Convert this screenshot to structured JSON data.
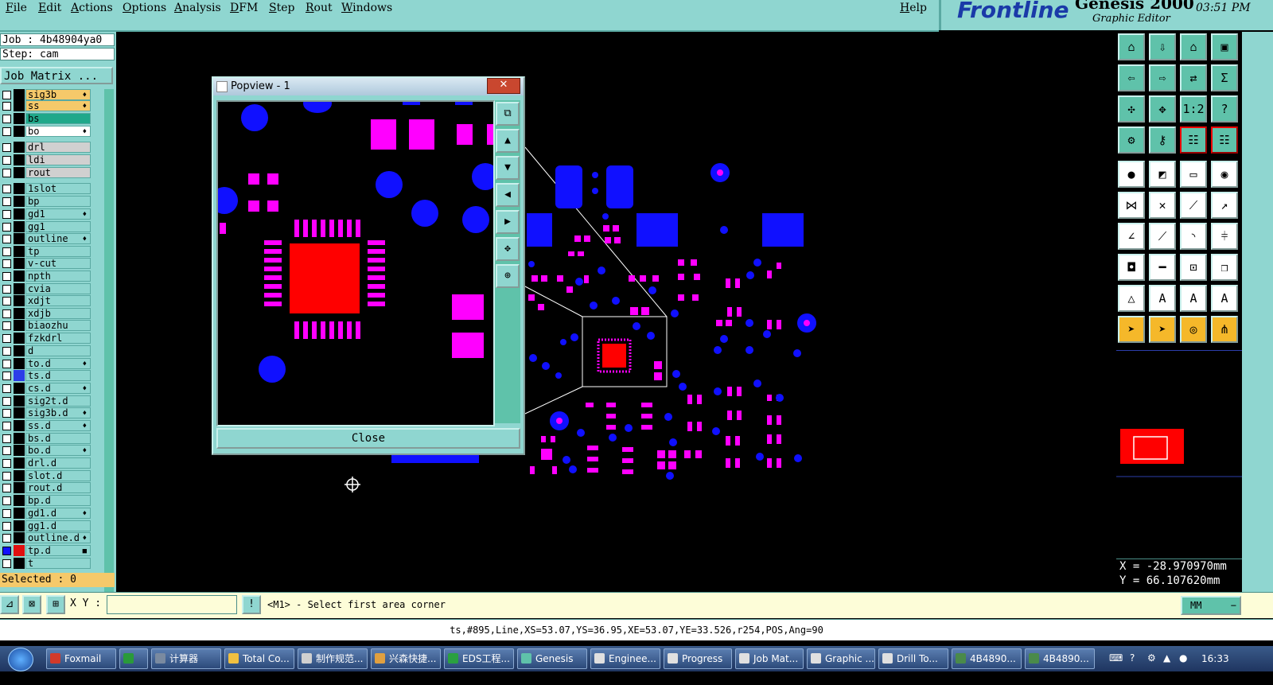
{
  "menubar": {
    "items": [
      "File",
      "Edit",
      "Actions",
      "Options",
      "Analysis",
      "DFM",
      "Step",
      "Rout",
      "Windows"
    ],
    "help": "Help"
  },
  "branding": {
    "brand": "Frontline",
    "product": "Genesis 2000",
    "subtitle": "Graphic Editor",
    "clock": "03:51 PM"
  },
  "job": {
    "job_line": "Job : 4b48904ya0",
    "step_line": "Step: cam",
    "matrix_button": "Job Matrix ...",
    "selected": "Selected : 0"
  },
  "layers": [
    {
      "name": "sig3b",
      "color": "#f5c96a",
      "swatch": "#000000",
      "flag": "♦",
      "checked": false
    },
    {
      "name": "ss",
      "color": "#f5c96a",
      "swatch": "#000000",
      "flag": "♦",
      "checked": false
    },
    {
      "name": "bs",
      "color": "#1fa88a",
      "swatch": "#000000",
      "flag": "",
      "checked": false
    },
    {
      "name": "bo",
      "color": "#ffffff",
      "swatch": "#000000",
      "flag": "♦",
      "checked": false
    },
    {
      "name": "drl",
      "color": "#d0d0d0",
      "swatch": "#000000",
      "flag": "",
      "checked": false
    },
    {
      "name": "ldi",
      "color": "#d0d0d0",
      "swatch": "#000000",
      "flag": "",
      "checked": false
    },
    {
      "name": "rout",
      "color": "#d0d0d0",
      "swatch": "#000000",
      "flag": "",
      "checked": false
    },
    {
      "name": "1slot",
      "color": "#8fd6d0",
      "swatch": "#000000",
      "flag": "",
      "checked": false
    },
    {
      "name": "bp",
      "color": "#8fd6d0",
      "swatch": "#000000",
      "flag": "",
      "checked": false
    },
    {
      "name": "gd1",
      "color": "#8fd6d0",
      "swatch": "#000000",
      "flag": "♦",
      "checked": false
    },
    {
      "name": "gg1",
      "color": "#8fd6d0",
      "swatch": "#000000",
      "flag": "",
      "checked": false
    },
    {
      "name": "outline",
      "color": "#8fd6d0",
      "swatch": "#000000",
      "flag": "♦",
      "checked": false
    },
    {
      "name": "tp",
      "color": "#8fd6d0",
      "swatch": "#000000",
      "flag": "",
      "checked": false
    },
    {
      "name": "v-cut",
      "color": "#8fd6d0",
      "swatch": "#000000",
      "flag": "",
      "checked": false
    },
    {
      "name": "npth",
      "color": "#8fd6d0",
      "swatch": "#000000",
      "flag": "",
      "checked": false
    },
    {
      "name": "cvia",
      "color": "#8fd6d0",
      "swatch": "#000000",
      "flag": "",
      "checked": false
    },
    {
      "name": "xdjt",
      "color": "#8fd6d0",
      "swatch": "#000000",
      "flag": "",
      "checked": false
    },
    {
      "name": "xdjb",
      "color": "#8fd6d0",
      "swatch": "#000000",
      "flag": "",
      "checked": false
    },
    {
      "name": "biaozhu",
      "color": "#8fd6d0",
      "swatch": "#000000",
      "flag": "",
      "checked": false
    },
    {
      "name": "fzkdrl",
      "color": "#8fd6d0",
      "swatch": "#000000",
      "flag": "",
      "checked": false
    },
    {
      "name": "d",
      "color": "#8fd6d0",
      "swatch": "#000000",
      "flag": "",
      "checked": false
    },
    {
      "name": "to.d",
      "color": "#8fd6d0",
      "swatch": "#000000",
      "flag": "♦",
      "checked": false
    },
    {
      "name": "ts.d",
      "color": "#8fd6d0",
      "swatch": "#2c3ee8",
      "flag": "",
      "checked": false
    },
    {
      "name": "cs.d",
      "color": "#8fd6d0",
      "swatch": "#000000",
      "flag": "♦",
      "checked": false
    },
    {
      "name": "sig2t.d",
      "color": "#8fd6d0",
      "swatch": "#000000",
      "flag": "",
      "checked": false
    },
    {
      "name": "sig3b.d",
      "color": "#8fd6d0",
      "swatch": "#000000",
      "flag": "♦",
      "checked": false
    },
    {
      "name": "ss.d",
      "color": "#8fd6d0",
      "swatch": "#000000",
      "flag": "♦",
      "checked": false
    },
    {
      "name": "bs.d",
      "color": "#8fd6d0",
      "swatch": "#000000",
      "flag": "",
      "checked": false
    },
    {
      "name": "bo.d",
      "color": "#8fd6d0",
      "swatch": "#000000",
      "flag": "♦",
      "checked": false
    },
    {
      "name": "drl.d",
      "color": "#8fd6d0",
      "swatch": "#000000",
      "flag": "",
      "checked": false
    },
    {
      "name": "slot.d",
      "color": "#8fd6d0",
      "swatch": "#000000",
      "flag": "",
      "checked": false
    },
    {
      "name": "rout.d",
      "color": "#8fd6d0",
      "swatch": "#000000",
      "flag": "",
      "checked": false
    },
    {
      "name": "bp.d",
      "color": "#8fd6d0",
      "swatch": "#000000",
      "flag": "",
      "checked": false
    },
    {
      "name": "gd1.d",
      "color": "#8fd6d0",
      "swatch": "#000000",
      "flag": "♦",
      "checked": false
    },
    {
      "name": "gg1.d",
      "color": "#8fd6d0",
      "swatch": "#000000",
      "flag": "",
      "checked": false
    },
    {
      "name": "outline.d",
      "color": "#8fd6d0",
      "swatch": "#000000",
      "flag": "♦",
      "checked": false
    },
    {
      "name": "tp.d",
      "color": "#8fd6d0",
      "swatch": "#e01010",
      "flag": "■",
      "checked": true
    },
    {
      "name": "t",
      "color": "#8fd6d0",
      "swatch": "#000000",
      "flag": "",
      "checked": false
    }
  ],
  "popview": {
    "title": "Popview - 1",
    "close_label": "Close"
  },
  "command": {
    "xy_label": "X Y :",
    "xy_value": "",
    "prompt": "<M1> - Select first area corner",
    "units": "MM"
  },
  "coords": {
    "x": "X = -28.970970mm",
    "y": "Y =  66.107620mm"
  },
  "status_line": "ts,#895,Line,XS=53.07,YS=36.95,XE=53.07,YE=33.526,r254,POS,Ang=90",
  "taskbar": {
    "items": [
      {
        "label": "Foxmail",
        "icon": "#d23a2a"
      },
      {
        "label": "",
        "icon": "#2a9a3a"
      },
      {
        "label": "计算器",
        "icon": "#7a8aa0"
      },
      {
        "label": "Total Co...",
        "icon": "#f0c040"
      },
      {
        "label": "制作规范...",
        "icon": "#d0d0d0"
      },
      {
        "label": "兴森快捷...",
        "icon": "#e0a040"
      },
      {
        "label": "EDS工程...",
        "icon": "#2aa040"
      },
      {
        "label": "Genesis",
        "icon": "#5fc2aa"
      },
      {
        "label": "Enginee...",
        "icon": "#e0e0e0"
      },
      {
        "label": "Progress",
        "icon": "#e0e0e0"
      },
      {
        "label": "Job Mat...",
        "icon": "#e0e0e0"
      },
      {
        "label": "Graphic ...",
        "icon": "#e0e0e0"
      },
      {
        "label": "Drill To...",
        "icon": "#e0e0e0"
      },
      {
        "label": "4B4890...",
        "icon": "#4a8a4a"
      },
      {
        "label": "4B4890...",
        "icon": "#4a8a4a"
      }
    ],
    "clock": "16:33"
  },
  "colors": {
    "pad_magenta": "#ff00ff",
    "via_blue": "#1010ff",
    "component_red": "#ff0000",
    "panel_teal": "#8fd6d0"
  }
}
